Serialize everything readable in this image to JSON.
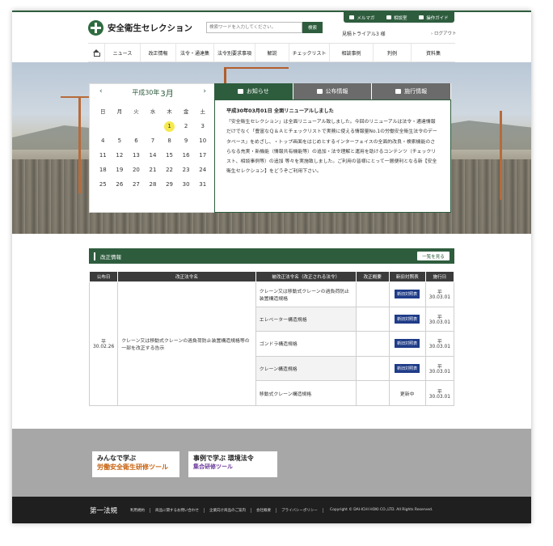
{
  "header": {
    "logo_text": "安全衛生セレクション",
    "search_placeholder": "検索ワードを入力してください。",
    "search_button": "検索",
    "util_links": [
      "メルマガ",
      "相談室",
      "操作ガイド"
    ],
    "user_name": "見積トライアル3 様",
    "logout": "ログアウト"
  },
  "nav": {
    "items": [
      "ニュース",
      "改正情報",
      "法令・通達集",
      "法令別要求事項",
      "解説",
      "チェックリスト",
      "相談事例",
      "判例",
      "資料集"
    ]
  },
  "calendar": {
    "era_label": "平成30年",
    "month_label": "3月",
    "weekdays": [
      "日",
      "月",
      "火",
      "水",
      "木",
      "金",
      "土"
    ],
    "rows": [
      [
        "",
        "",
        "",
        "",
        "1",
        "2",
        "3"
      ],
      [
        "4",
        "5",
        "6",
        "7",
        "8",
        "9",
        "10"
      ],
      [
        "11",
        "12",
        "13",
        "14",
        "15",
        "16",
        "17"
      ],
      [
        "18",
        "19",
        "20",
        "21",
        "22",
        "23",
        "24"
      ],
      [
        "25",
        "26",
        "27",
        "28",
        "29",
        "30",
        "31"
      ]
    ],
    "today": "1"
  },
  "notices": {
    "tabs": [
      "お知らせ",
      "公布情報",
      "施行情報"
    ],
    "title": "平成30年03月01日 全面リニューアルしました",
    "body": "「安全衛生セレクション」は全面リニューアル致しました。今回のリニューアルは法令・通達情報だけでなく「豊富なＱ＆Ａとチェックリストで実務に使える情報量No.1の労働安全衛生法令のデータベース」をめざし、・トップ画面をはじめとするインターフェイスの全面的改良・検索機能のさらなる充実・新機能（情報共有機能等）の追加・法令理解と運用を助けるコンテンツ（チェックリスト、相談事例等）の追加 等々を実施致しました。ご利用の皆様にとって一層便利となる新【安全衛生セレクション】をどうぞご利用下さい。"
  },
  "revisions": {
    "title": "改正情報",
    "more_button": "一覧を見る",
    "headers": [
      "公布日",
      "改正法令名",
      "被改正法令名（改正される法令）",
      "改正概要",
      "新旧対照表",
      "施行日"
    ],
    "date": "平30.02.26",
    "law_name": "クレーン又は移動式クレーンの過負荷防止装置構造規格等の一部を改正する告示",
    "rows": [
      {
        "target": "クレーン又は移動式クレーンの過負荷防止装置構造規格",
        "table": "新旧対照表",
        "effective": "平30.03.01"
      },
      {
        "target": "エレベーター構造規格",
        "table": "新旧対照表",
        "effective": "平30.03.01"
      },
      {
        "target": "ゴンドラ構造規格",
        "table": "新旧対照表",
        "effective": "平30.03.01"
      },
      {
        "target": "クレーン構造規格",
        "table": "新旧対照表",
        "effective": "平30.03.01"
      },
      {
        "target": "移動式クレーン構造規格",
        "table": "更新中",
        "effective": "平30.03.01"
      }
    ]
  },
  "banners": {
    "b1_line1": "みんなで学ぶ",
    "b1_line2": "労働安全衛生研修ツール",
    "b2_line1": "事例で学ぶ 環境法令",
    "b2_line2": "集合研修ツール"
  },
  "footer": {
    "logo": "第一法規",
    "links": [
      "利用規約",
      "商品に関するお問い合わせ",
      "企業向け商品のご案内",
      "会社概要",
      "プライバシーポリシー"
    ],
    "copyright": "Copyright © DAI-ICHI HOKI CO.,LTD. All Rights Reserved."
  },
  "colors": {
    "brand_green": "#2e5d3e",
    "badge_blue": "#1f3c88",
    "today_yellow": "#f5e94e"
  }
}
